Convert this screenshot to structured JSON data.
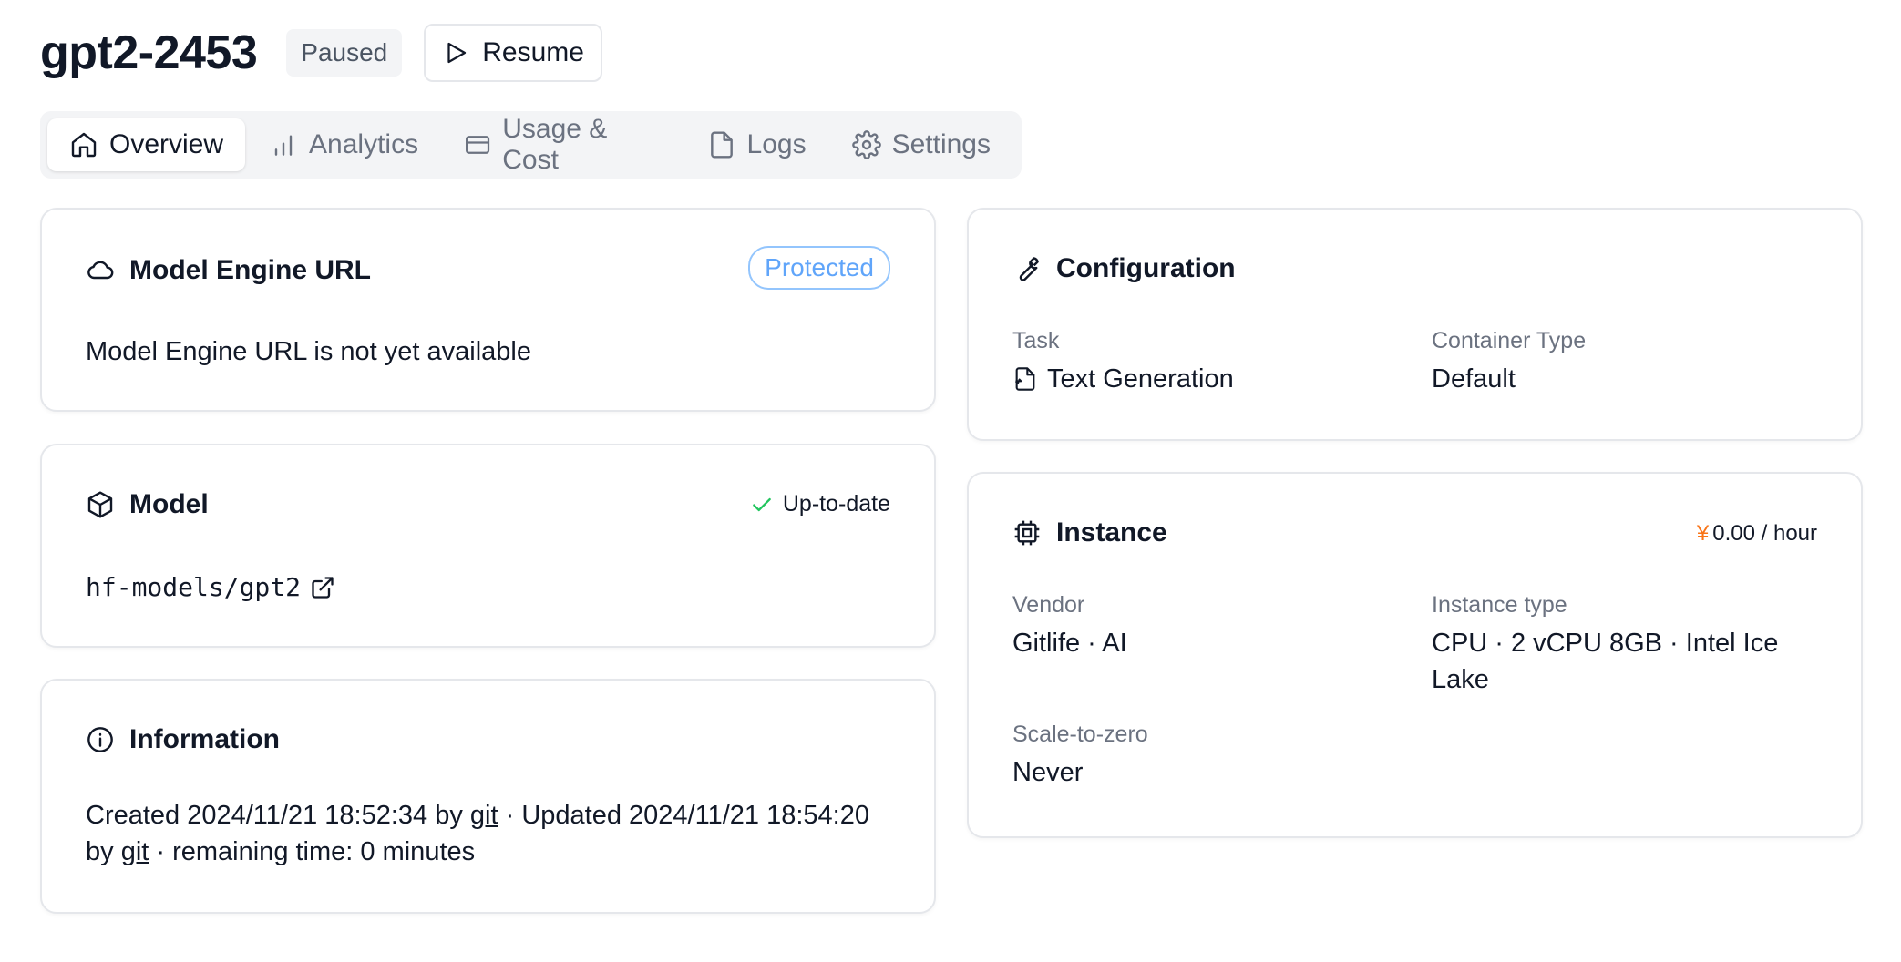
{
  "header": {
    "title": "gpt2-2453",
    "status": "Paused",
    "resume_label": "Resume"
  },
  "tabs": [
    {
      "label": "Overview",
      "icon": "home-icon",
      "active": true
    },
    {
      "label": "Analytics",
      "icon": "bar-chart-icon",
      "active": false
    },
    {
      "label": "Usage & Cost",
      "icon": "credit-card-icon",
      "active": false
    },
    {
      "label": "Logs",
      "icon": "file-icon",
      "active": false
    },
    {
      "label": "Settings",
      "icon": "gear-icon",
      "active": false
    }
  ],
  "engine_url": {
    "title": "Model Engine URL",
    "badge": "Protected",
    "text": "Model Engine URL is not yet available"
  },
  "model": {
    "title": "Model",
    "status": "Up-to-date",
    "repo": "hf-models/gpt2"
  },
  "information": {
    "title": "Information",
    "created_prefix": "Created 2024/11/21 18:52:34 by ",
    "created_by": "git",
    "updated_prefix": " · Updated 2024/11/21 18:54:20",
    "by_prefix": "by ",
    "updated_by": "git",
    "remaining": " · remaining time: 0 minutes"
  },
  "configuration": {
    "title": "Configuration",
    "task_label": "Task",
    "task_value": "Text Generation",
    "container_label": "Container Type",
    "container_value": "Default"
  },
  "instance": {
    "title": "Instance",
    "price_symbol": "¥",
    "price_value": "0.00 / hour",
    "vendor_label": "Vendor",
    "vendor_value": "Gitlife · AI",
    "type_label": "Instance type",
    "type_value_line1": "CPU · 2 vCPU 8GB · Intel Ice",
    "type_value_line2": "Lake",
    "scale_label": "Scale-to-zero",
    "scale_value": "Never"
  },
  "colors": {
    "accent_blue": "#60a5fa",
    "success_green": "#22c55e",
    "price_orange": "#f97316"
  }
}
